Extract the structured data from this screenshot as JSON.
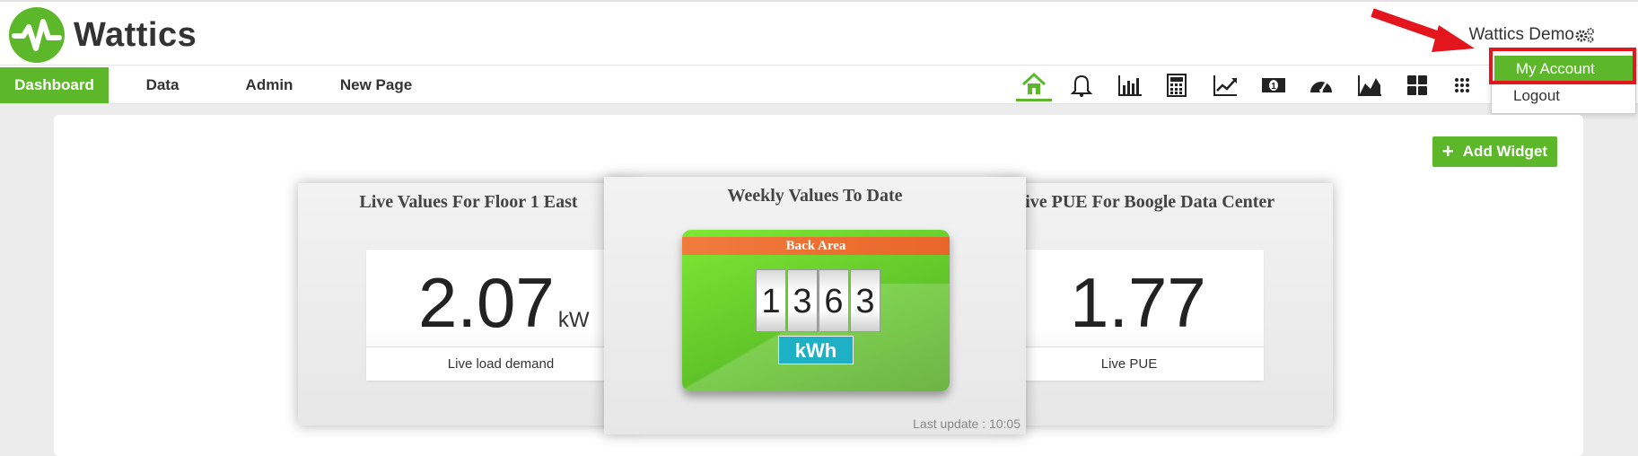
{
  "app": {
    "name": "Wattics"
  },
  "user": {
    "name": "Wattics Demo",
    "icon": "gears-icon"
  },
  "nav": {
    "tabs": [
      {
        "label": "Dashboard",
        "active": true
      },
      {
        "label": "Data"
      },
      {
        "label": "Admin"
      },
      {
        "label": "New Page"
      }
    ],
    "icons": [
      "home-icon",
      "bell-icon",
      "bar-chart-icon",
      "calculator-icon",
      "trend-icon",
      "money-icon",
      "gauge-icon",
      "area-chart-icon",
      "grid-icon",
      "dots-grid-icon"
    ]
  },
  "account_menu": {
    "items": [
      "My Account",
      "Logout"
    ],
    "highlighted": "My Account"
  },
  "toolbar": {
    "add_widget_label": "Add Widget"
  },
  "widgets": {
    "left": {
      "title": "Live Values For Floor 1 East",
      "value": "2.07",
      "unit": "kW",
      "caption": "Live load demand"
    },
    "center": {
      "title": "Weekly Values To Date",
      "meter_label": "Back Area",
      "digits": [
        "1",
        "3",
        "6",
        "3"
      ],
      "unit": "kWh",
      "last_update": "Last update : 10:05"
    },
    "right": {
      "title": "Live PUE For Boogle Data Center",
      "value": "1.77",
      "caption": "Live PUE"
    }
  },
  "colors": {
    "accent": "#5cb82a",
    "highlight": "#e3161e",
    "meter_header": "#e9662a",
    "kwh_badge": "#1eb0c4"
  }
}
